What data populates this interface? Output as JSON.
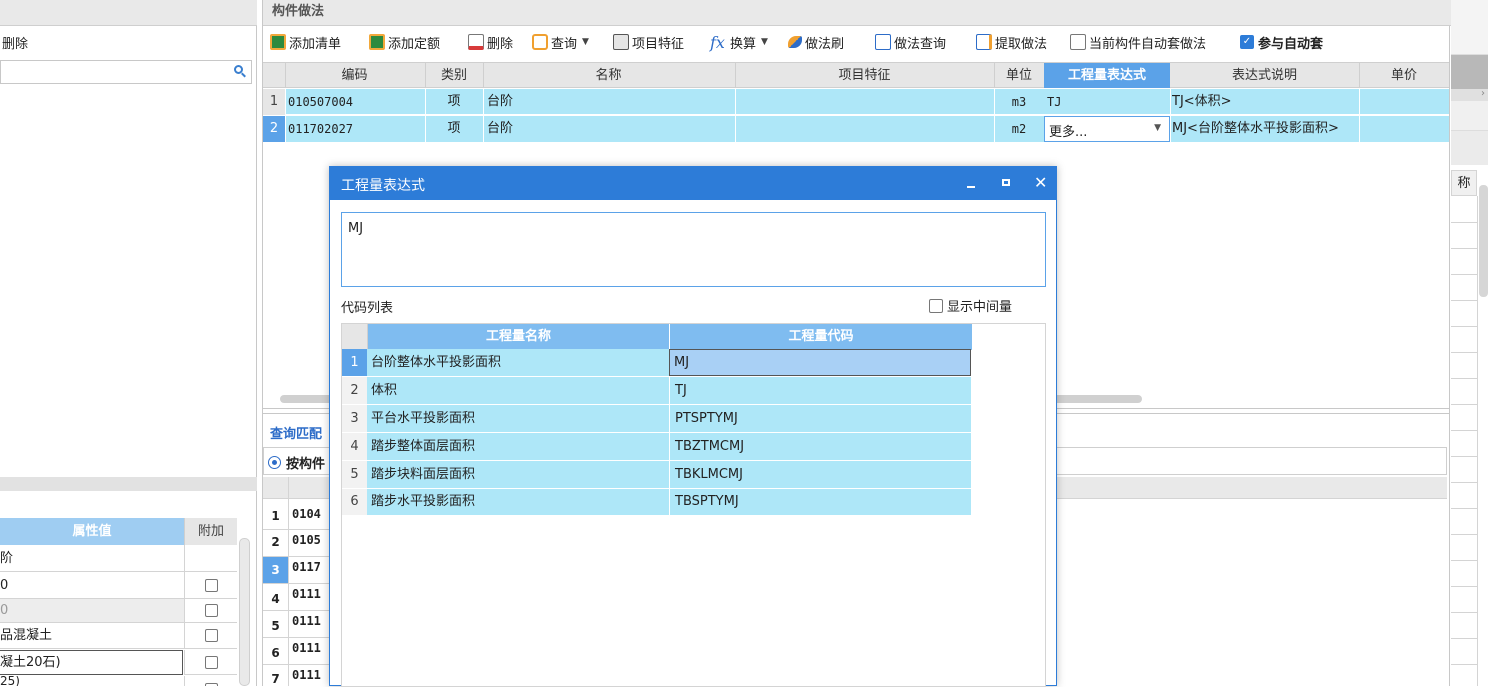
{
  "left_panel": {
    "delete_label": "删除",
    "search_icon": "search-icon",
    "attr_header": "属性值",
    "extra_header": "附加",
    "attr_rows": [
      "阶",
      "0",
      "0",
      "品混凝土",
      "凝土20石)",
      "25)"
    ]
  },
  "main_panel": {
    "title": "构件做法",
    "toolbar": [
      {
        "label": "添加清单",
        "icon": "add-list-icon"
      },
      {
        "label": "添加定额",
        "icon": "add-quota-icon"
      },
      {
        "label": "删除",
        "icon": "delete-icon"
      },
      {
        "label": "查询",
        "icon": "query-icon"
      },
      {
        "label": "项目特征",
        "icon": "feature-icon"
      },
      {
        "label": "换算",
        "icon": "fx-icon"
      },
      {
        "label": "做法刷",
        "icon": "brush-icon"
      },
      {
        "label": "做法查询",
        "icon": "method-query-icon"
      },
      {
        "label": "提取做法",
        "icon": "extract-icon"
      },
      {
        "label": "当前构件自动套做法",
        "icon": "auto-apply-icon"
      },
      {
        "label": "参与自动套",
        "icon": "checkbox-checked-icon"
      }
    ],
    "columns": [
      "编码",
      "类别",
      "名称",
      "项目特征",
      "单位",
      "工程量表达式",
      "表达式说明",
      "单价"
    ],
    "rows": [
      {
        "num": "1",
        "code": "010507004",
        "type": "项",
        "name": "台阶",
        "feature": "",
        "unit": "m3",
        "expr": "TJ",
        "desc": "TJ<体积>"
      },
      {
        "num": "2",
        "code": "011702027",
        "type": "项",
        "name": "台阶",
        "feature": "",
        "unit": "m2",
        "expr": "更多...",
        "desc": "MJ<台阶整体水平投影面积>"
      }
    ]
  },
  "query_panel": {
    "tab_label": "查询匹配",
    "radio_label": "按构件",
    "rows": [
      {
        "num": "1",
        "code": "0104"
      },
      {
        "num": "2",
        "code": "0105"
      },
      {
        "num": "3",
        "code": "0117"
      },
      {
        "num": "4",
        "code": "0111"
      },
      {
        "num": "5",
        "code": "0111"
      },
      {
        "num": "6",
        "code": "0111"
      },
      {
        "num": "7",
        "code": "0111"
      }
    ]
  },
  "right_panel": {
    "header_fragment": "称"
  },
  "dialog": {
    "title": "工程量表达式",
    "expression_value": "MJ",
    "code_list_label": "代码列表",
    "show_intermediate_label": "显示中间量",
    "columns": [
      "工程量名称",
      "工程量代码"
    ],
    "rows": [
      {
        "num": "1",
        "name": "台阶整体水平投影面积",
        "code": "MJ"
      },
      {
        "num": "2",
        "name": "体积",
        "code": "TJ"
      },
      {
        "num": "3",
        "name": "平台水平投影面积",
        "code": "PTSPTYMJ"
      },
      {
        "num": "4",
        "name": "踏步整体面层面积",
        "code": "TBZTMCMJ"
      },
      {
        "num": "5",
        "name": "踏步块料面层面积",
        "code": "TBKLMCMJ"
      },
      {
        "num": "6",
        "name": "踏步水平投影面积",
        "code": "TBSPTYMJ"
      }
    ]
  },
  "colors": {
    "accent": "#2d7cd8",
    "row_cyan": "#aee7f8",
    "header_gray": "#e6e6e6",
    "header_blue": "#9fcdf2"
  }
}
